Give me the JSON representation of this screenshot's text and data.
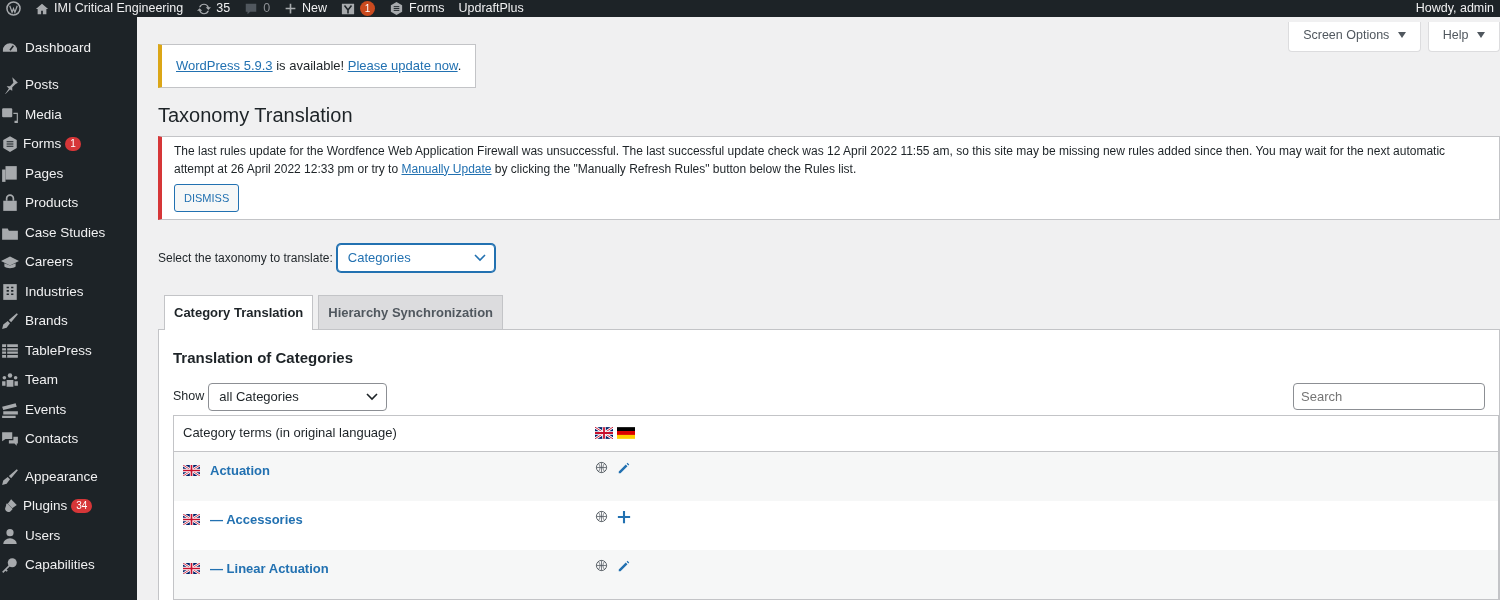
{
  "admin_bar": {
    "site": "IMI Critical Engineering",
    "updates": "35",
    "comments": "0",
    "new": "New",
    "yoast_count": "1",
    "forms": "Forms",
    "updraft": "UpdraftPlus",
    "greeting": "Howdy, admin"
  },
  "sidebar": {
    "items": [
      {
        "label": "Dashboard",
        "gap_after": true
      },
      {
        "label": "Posts"
      },
      {
        "label": "Media"
      },
      {
        "label": "Forms",
        "badge": "1"
      },
      {
        "label": "Pages"
      },
      {
        "label": "Products"
      },
      {
        "label": "Case Studies"
      },
      {
        "label": "Careers"
      },
      {
        "label": "Industries"
      },
      {
        "label": "Brands"
      },
      {
        "label": "TablePress"
      },
      {
        "label": "Team"
      },
      {
        "label": "Events"
      },
      {
        "label": "Contacts",
        "gap_after": true
      },
      {
        "label": "Appearance"
      },
      {
        "label": "Plugins",
        "badge": "34"
      },
      {
        "label": "Users"
      },
      {
        "label": "Capabilities"
      }
    ]
  },
  "screen_options": [
    "Screen Options",
    "Help"
  ],
  "update_notice": {
    "link": "WordPress 5.9.3",
    "middle": " is available! ",
    "action": "Please update now",
    "end": "."
  },
  "page_title": "Taxonomy Translation",
  "error_notice": {
    "before": "The last rules update for the Wordfence Web Application Firewall was unsuccessful. The last successful update check was 12 April 2022 11:55 am, so this site may be missing new rules added since then. You may wait for the next automatic attempt at 26 April 2022 12:33 pm or try to ",
    "link": "Manually Update",
    "after": " by clicking the \"Manually Refresh Rules\" button below the Rules list.",
    "button": "DISMISS"
  },
  "taxonomy_select": {
    "label": "Select the taxonomy to translate:",
    "value": "Categories"
  },
  "tabs": [
    {
      "label": "Category Translation",
      "selected": true
    },
    {
      "label": "Hierarchy Synchronization",
      "selected": false
    }
  ],
  "section_title": "Translation of Categories",
  "show_filter": {
    "label": "Show",
    "value": "all Categories"
  },
  "search": {
    "placeholder": "Search"
  },
  "table": {
    "header": "Category terms (in original language)",
    "rows": [
      {
        "term": "Actuation",
        "kind": "edit"
      },
      {
        "term": "— Accessories",
        "kind": "add"
      },
      {
        "term": "— Linear Actuation",
        "kind": "edit"
      }
    ]
  }
}
